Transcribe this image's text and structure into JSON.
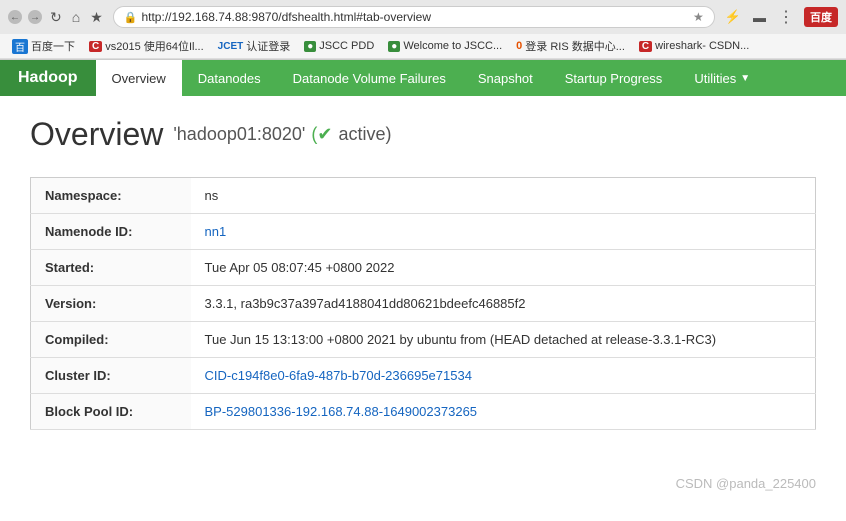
{
  "browser": {
    "url": "http://192.168.74.88:9870/dfshealth.html#tab-overview",
    "bookmarks": [
      {
        "label": "百度一下",
        "color": "#1976d2"
      },
      {
        "label": "C  vs2015 使用64位Il...",
        "color": "#c62828"
      },
      {
        "label": "JCET  认证登录",
        "color": "#1565c0"
      },
      {
        "label": "JSCC PDD",
        "color": "#388e3c"
      },
      {
        "label": "Welcome to JSCC...",
        "color": "#388e3c"
      },
      {
        "label": "0  登录 RIS 数据中心...",
        "color": "#e65100"
      },
      {
        "label": "C  wireshark- CSDN...",
        "color": "#c62828"
      }
    ]
  },
  "navbar": {
    "brand": "Hadoop",
    "items": [
      {
        "label": "Overview",
        "active": true
      },
      {
        "label": "Datanodes",
        "active": false
      },
      {
        "label": "Datanode Volume Failures",
        "active": false
      },
      {
        "label": "Snapshot",
        "active": false
      },
      {
        "label": "Startup Progress",
        "active": false
      },
      {
        "label": "Utilities",
        "active": false,
        "dropdown": true
      }
    ]
  },
  "page": {
    "title": "Overview",
    "subtitle": "'hadoop01:8020'",
    "status": "active"
  },
  "table": {
    "rows": [
      {
        "label": "Namespace:",
        "value": "ns",
        "type": "text"
      },
      {
        "label": "Namenode ID:",
        "value": "nn1",
        "type": "link"
      },
      {
        "label": "Started:",
        "value": "Tue Apr 05 08:07:45  +0800 2022",
        "type": "red"
      },
      {
        "label": "Version:",
        "value": "3.3.1, ra3b9c37a397ad4188041dd80621bdeefc46885f2",
        "type": "text"
      },
      {
        "label": "Compiled:",
        "value": "Tue Jun 15 13:13:00  +0800 2021 by ubuntu from (HEAD detached at release-3.3.1-RC3)",
        "type": "red"
      },
      {
        "label": "Cluster ID:",
        "value": "CID-c194f8e0-6fa9-487b-b70d-236695e71534",
        "type": "link"
      },
      {
        "label": "Block Pool ID:",
        "value": "BP-529801336-192.168.74.88-1649002373265",
        "type": "link"
      }
    ]
  },
  "watermark": {
    "text": "CSDN @panda_225400"
  }
}
